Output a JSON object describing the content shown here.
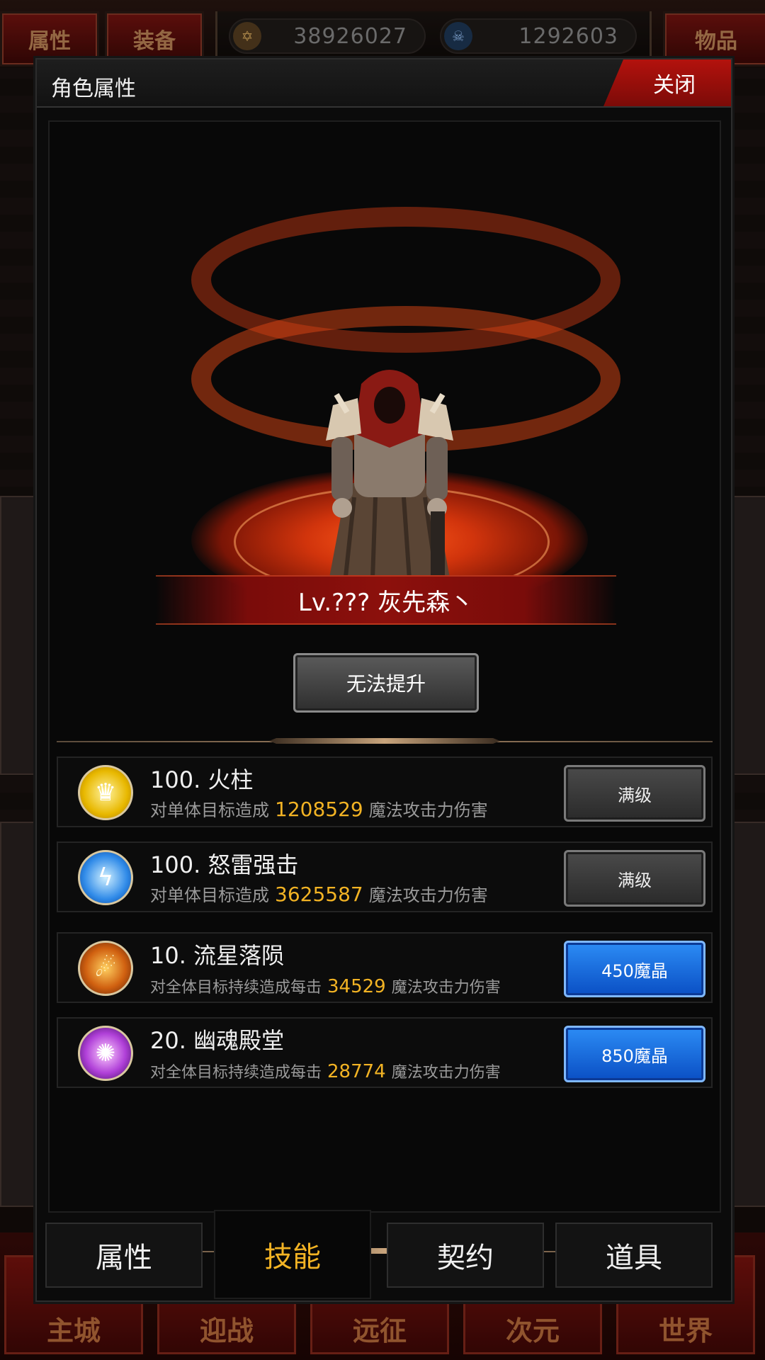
{
  "background": {
    "top_tabs": [
      "属性",
      "装备",
      "物品"
    ],
    "currency": [
      {
        "icon": "gold-emblem-icon",
        "value": "38926027"
      },
      {
        "icon": "skull-gem-icon",
        "value": "1292603"
      }
    ],
    "bottom_nav": [
      "主城",
      "迎战",
      "远征",
      "次元",
      "世界"
    ]
  },
  "modal": {
    "title": "角色属性",
    "close_label": "关闭",
    "character": {
      "name_line": "Lv.??? 灰先森丶"
    },
    "upgrade_button": "无法提升",
    "skills": [
      {
        "name": "100. 火柱",
        "desc_pre": "对单体目标造成",
        "value": "1208529",
        "desc_post": "魔法攻击力伤害",
        "button": "满级",
        "button_style": "grey",
        "icon": "fire-pillar-icon"
      },
      {
        "name": "100. 怒雷强击",
        "desc_pre": "对单体目标造成",
        "value": "3625587",
        "desc_post": "魔法攻击力伤害",
        "button": "满级",
        "button_style": "grey",
        "icon": "thunder-strike-icon"
      },
      {
        "name": "10. 流星落陨",
        "desc_pre": "对全体目标持续造成每击",
        "value": "34529",
        "desc_post": "魔法攻击力伤害",
        "button": "450魔晶",
        "button_style": "blue",
        "icon": "meteor-icon"
      },
      {
        "name": "20. 幽魂殿堂",
        "desc_pre": "对全体目标持续造成每击",
        "value": "28774",
        "desc_post": "魔法攻击力伤害",
        "button": "850魔晶",
        "button_style": "blue",
        "icon": "ghost-hall-icon"
      }
    ],
    "tabs": [
      "属性",
      "技能",
      "契约",
      "道具"
    ],
    "active_tab": "技能"
  },
  "colors": {
    "accent_gold": "#f2b324",
    "close_red": "#b3120d",
    "upgrade_blue": "#1a6ee0"
  }
}
